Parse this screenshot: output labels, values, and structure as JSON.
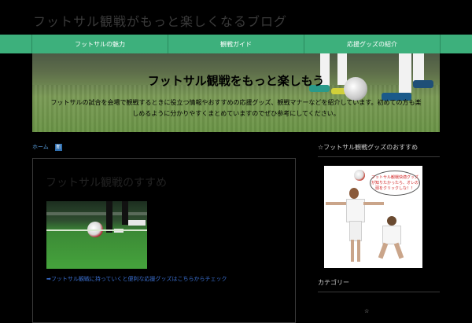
{
  "header": {
    "site_title": "フットサル観戦がもっと楽しくなるブログ"
  },
  "nav": {
    "items": [
      {
        "label": "フットサルの魅力"
      },
      {
        "label": "観戦ガイド"
      },
      {
        "label": "応援グッズの紹介"
      }
    ]
  },
  "hero": {
    "title": "フットサル観戦をもっと楽しもう",
    "description": "フットサルの試合を会場で観戦するときに役立つ情報やおすすめの応援グッズ、観戦マナーなどを紹介しています。初めての方も楽しめるように分かりやすくまとめていますのでぜひ参考にしてください。"
  },
  "breadcrumb": {
    "home": "ホーム",
    "current": "新"
  },
  "post": {
    "title": "フットサル観戦のすすめ",
    "link": "フットサル観戦に持っていくと便利な応援グッズはこちらからチェック"
  },
  "sidebar": {
    "widget1_title": "☆フットサル観戦グッズのおすすめ",
    "bubble_text": "フットサル観戦快適グッズが知りたかったら、オレの頭をクリックしな！！",
    "widget2_title": "カテゴリー",
    "bottom_star": "☆"
  },
  "colors": {
    "nav": "#3db07c",
    "background": "#000000",
    "link": "#3a6fd0"
  }
}
